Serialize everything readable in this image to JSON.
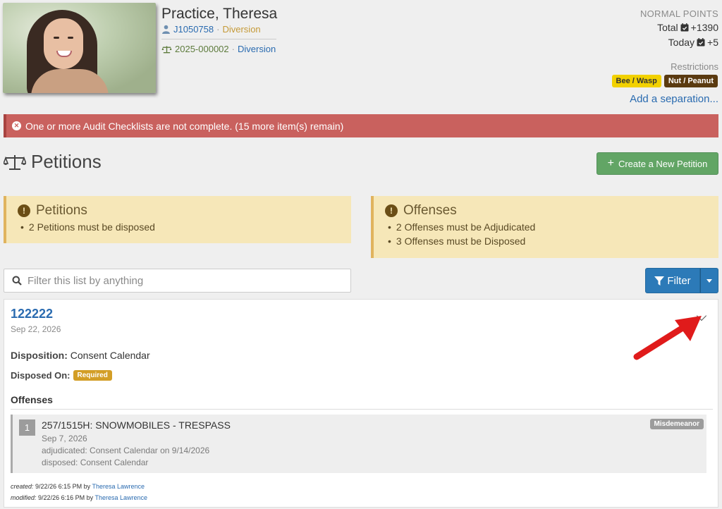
{
  "person": {
    "name": "Practice, Theresa",
    "id": "J1050758",
    "program": "Diversion",
    "case_number": "2025-000002",
    "case_program": "Diversion"
  },
  "points": {
    "title": "NORMAL POINTS",
    "total_label": "Total",
    "total_value": "+1390",
    "today_label": "Today",
    "today_value": "+5"
  },
  "restrictions": {
    "title": "Restrictions",
    "items": [
      "Bee / Wasp",
      "Nut / Peanut"
    ],
    "add_link": "Add a separation..."
  },
  "alert": {
    "text": "One or more Audit Checklists are not complete. (15 more item(s) remain)"
  },
  "page": {
    "title": "Petitions",
    "create_button": "Create a New Petition"
  },
  "warnings": {
    "petitions": {
      "title": "Petitions",
      "items": [
        "2 Petitions must be disposed"
      ]
    },
    "offenses": {
      "title": "Offenses",
      "items": [
        "2 Offenses must be Adjudicated",
        "3 Offenses must be Disposed"
      ]
    }
  },
  "filter": {
    "placeholder": "Filter this list by anything",
    "button": "Filter"
  },
  "petition": {
    "number": "122222",
    "date": "Sep 22, 2026",
    "disposition_label": "Disposition:",
    "disposition_value": "Consent Calendar",
    "disposed_on_label": "Disposed On:",
    "disposed_on_badge": "Required",
    "offenses_heading": "Offenses",
    "offense": {
      "index": "1",
      "title": "257/1515H: SNOWMOBILES - TRESPASS",
      "date": "Sep 7, 2026",
      "adjudicated": "adjudicated: Consent Calendar on 9/14/2026",
      "disposed": "disposed: Consent Calendar",
      "level": "Misdemeanor"
    },
    "created_label": "created:",
    "created_text": "9/22/26 6:15 PM by",
    "created_by": "Theresa Lawrence",
    "modified_label": "modified:",
    "modified_text": "9/22/26 6:16 PM by",
    "modified_by": "Theresa Lawrence"
  },
  "colors": {
    "alert": "#c9615e",
    "warning_bg": "#f6e7b8",
    "create_button": "#62a565",
    "filter_button": "#2c7ab8",
    "link": "#2a6bb0",
    "annotation_arrow": "#e01b1b"
  }
}
